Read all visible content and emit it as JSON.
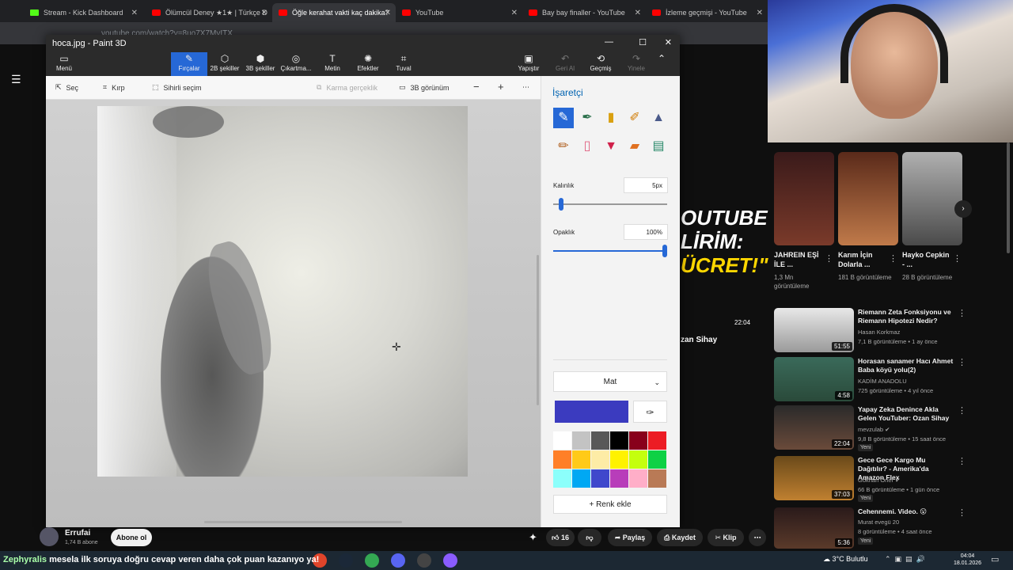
{
  "browser": {
    "tabs": [
      {
        "label": "Stream - Kick Dashboard",
        "icon": "kick-icon"
      },
      {
        "label": "Ölümcül Deney ★1★ | Türkçe D",
        "icon": "youtube-icon"
      },
      {
        "label": "Öğle kerahat vakti kaç dakika?",
        "icon": "youtube-icon"
      },
      {
        "label": "YouTube",
        "icon": "youtube-icon"
      },
      {
        "label": "Bay bay finaller - YouTube",
        "icon": "youtube-icon"
      },
      {
        "label": "İzleme geçmişi - YouTube",
        "icon": "youtube-icon"
      }
    ],
    "address": "youtube.com/watch?v=8uo7X7MvITX"
  },
  "paint": {
    "title": "hoca.jpg - Paint 3D",
    "ribbon": {
      "menu": "Menü",
      "brushes": "Fırçalar",
      "shapes2d": "2B şekiller",
      "shapes3d": "3B şekiller",
      "stickers": "Çıkartma...",
      "text": "Metin",
      "effects": "Efektler",
      "canvas": "Tuval",
      "paste": "Yapıştır",
      "undo": "Geri Al",
      "history": "Geçmiş",
      "redo": "Yinele"
    },
    "toolbar": {
      "select": "Seç",
      "crop": "Kırp",
      "magic": "Sihirli seçim",
      "mixed": "Karma gerçeklik",
      "view3d": "3B görünüm"
    },
    "panel": {
      "title": "İşaretçi",
      "thickness_label": "Kalınlık",
      "thickness_value": "5px",
      "thickness_level": 0.05,
      "opacity_label": "Opaklık",
      "opacity_value": "100%",
      "opacity_level": 1.0,
      "finish": "Mat",
      "current_color": "#3b3bbf",
      "add_color": "Renk ekle",
      "palette": [
        "#ffffff",
        "#c3c3c3",
        "#585858",
        "#000000",
        "#88001b",
        "#ec1c24",
        "#ff7f27",
        "#ffca18",
        "#fdeca6",
        "#fff200",
        "#c4ff0e",
        "#0ed145",
        "#8cfffb",
        "#00a8f3",
        "#3f48cc",
        "#b83dba",
        "#ffaec8",
        "#b97a56"
      ]
    }
  },
  "youtube": {
    "promo_line1": "OUTUBE",
    "promo_line2": "LİRİM:",
    "promo_line3": "ÜCRET!\"",
    "video_time": "22:04",
    "video_author": "zan Sihay",
    "channel": "Errufai",
    "subs": "1,74 B abone",
    "subscribe": "Abone ol",
    "likes": "16",
    "share": "Paylaş",
    "save": "Kaydet",
    "clip": "Klip",
    "shorts": [
      {
        "title": "JAHREIN EŞİ İLE ...",
        "views": "1,3 Mn görüntüleme"
      },
      {
        "title": "Karım İçin Dolarla ...",
        "views": "181 B görüntüleme"
      },
      {
        "title": "Hayko Cepkin - ...",
        "views": "28 B görüntüleme"
      }
    ],
    "videos": [
      {
        "title": "Riemann Zeta Fonksiyonu ve Riemann Hipotezi Nedir?",
        "channel": "Hasan Korkmaz",
        "meta": "7,1 B görüntüleme • 1 ay önce",
        "duration": "51:55",
        "new": ""
      },
      {
        "title": "Horasan sanamer Hacı Ahmet Baba köyü yolu(2)",
        "channel": "KADİM ANADOLU",
        "meta": "725 görüntüleme • 4 yıl önce",
        "duration": "4:58",
        "new": ""
      },
      {
        "title": "Yapay Zeka Denince Akla Gelen YouTuber: Ozan Sihay",
        "channel": "mevzulab ✔",
        "meta": "9,8 B görüntüleme • 15 saat önce",
        "duration": "22:04",
        "new": "Yeni"
      },
      {
        "title": "Gece Gece Kargo Mu Dağıtılır? - Amerika'da Amazon Flex",
        "channel": "Gokhan Oner ✔",
        "meta": "66 B görüntüleme • 1 gün önce",
        "duration": "37:03",
        "new": "Yeni"
      },
      {
        "title": "Cehennemi. Video. 😮",
        "channel": "Murat evegü 20",
        "meta": "8 görüntüleme • 4 saat önce",
        "duration": "5:36",
        "new": "Yeni"
      }
    ]
  },
  "taskbar": {
    "ticker_name": "Zephyralis",
    "ticker_text": "mesela ilk soruya doğru cevap veren daha çok puan kazanıyo ya!",
    "weather": "3°C  Bulutlu",
    "time": "04:04",
    "date": "18.01.2026"
  }
}
